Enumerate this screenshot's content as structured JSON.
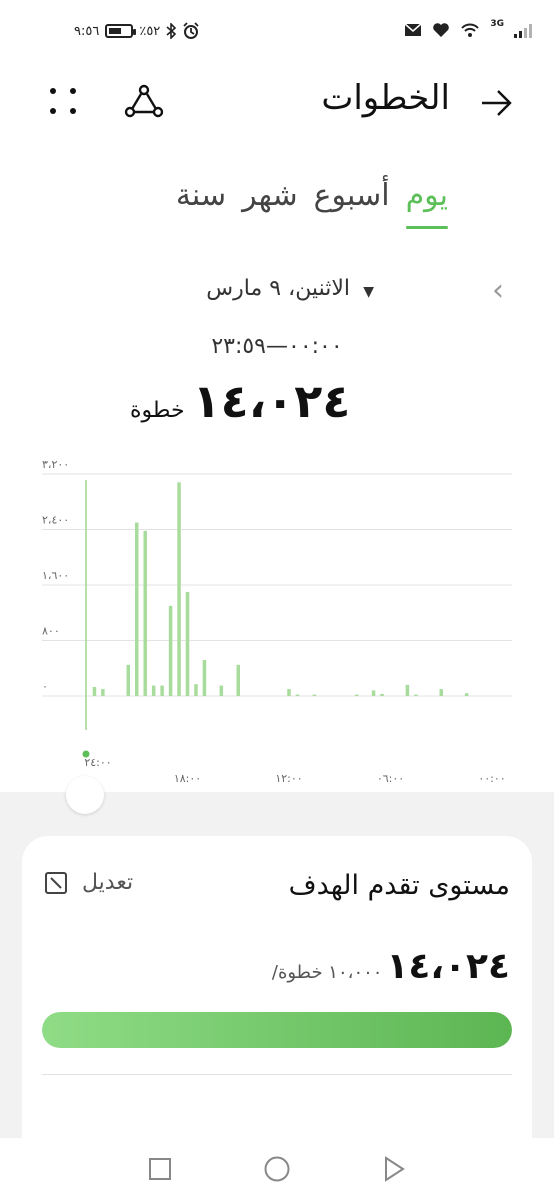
{
  "status_bar": {
    "time": "٩:٥٦",
    "battery": "٪٥٢",
    "network": "3G"
  },
  "header": {
    "title": "الخطوات",
    "back_icon": "arrow-right-icon",
    "share_icon": "share-icon",
    "more_icon": "dots-grid-icon"
  },
  "tabs": [
    {
      "label": "يوم",
      "active": true
    },
    {
      "label": "أسبوع",
      "active": false
    },
    {
      "label": "شهر",
      "active": false
    },
    {
      "label": "سنة",
      "active": false
    }
  ],
  "summary": {
    "date": "الاثنين، ٩ مارس",
    "time_range": "٠٠:٠٠—٢٣:٥٩",
    "total": "١٤،٠٢٤",
    "unit": "خطوة"
  },
  "chart_data": {
    "type": "bar",
    "y_ticks": [
      "٣،٢٠٠",
      "٢،٤٠٠",
      "١،٦٠٠",
      "٨٠٠",
      "٠"
    ],
    "x_ticks": [
      "٢٤:٠٠",
      "١٨:٠٠",
      "١٢:٠٠",
      "٠٦:٠٠",
      "٠٠:٠٠"
    ],
    "ylim": [
      0,
      3200
    ],
    "bar_color": "#a8dc9c",
    "x": [
      23.5,
      23.0,
      21.5,
      21.0,
      20.5,
      20.0,
      19.5,
      19.0,
      18.5,
      18.0,
      17.5,
      17.0,
      16.0,
      15.0,
      12.0,
      11.5,
      10.5,
      8.0,
      7.0,
      6.5,
      5.0,
      4.5,
      3.0,
      1.5
    ],
    "values": [
      130,
      100,
      450,
      2500,
      2380,
      150,
      150,
      1300,
      3080,
      1500,
      170,
      520,
      150,
      450,
      100,
      20,
      20,
      20,
      80,
      30,
      160,
      20,
      100,
      40
    ]
  },
  "goal_card": {
    "title": "مستوى تقدم الهدف",
    "edit_label": "تعديل",
    "edit_icon": "edit-icon",
    "progress_value": "١٤،٠٢٤",
    "goal_text": "/١٠،٠٠٠ خطوة",
    "progress_fraction": 1.0,
    "accent": "#5cbf57"
  },
  "nav": {
    "recent_icon": "square-icon",
    "home_icon": "circle-icon",
    "back_icon": "triangle-back-icon"
  }
}
